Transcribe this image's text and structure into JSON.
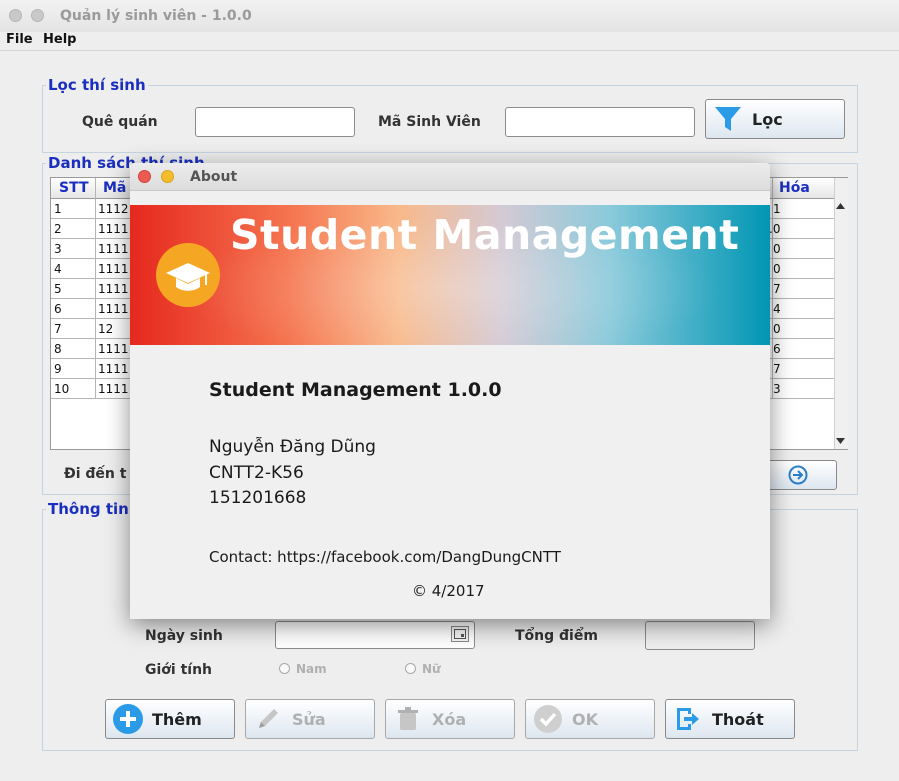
{
  "window": {
    "title": "Quản lý sinh viên - 1.0.0"
  },
  "menu": {
    "file": "File",
    "help": "Help"
  },
  "filter": {
    "group_label": "Lọc thí sinh",
    "hometown_label": "Quê quán",
    "hometown_value": "",
    "student_id_label": "Mã Sinh Viên",
    "student_id_value": "",
    "filter_button": "Lọc"
  },
  "list": {
    "group_label": "Danh sách thí sinh",
    "columns": {
      "stt": "STT",
      "ma": "Mã",
      "hoa": "Hóa"
    },
    "rows": [
      {
        "stt": "1",
        "ma": "1112",
        "hoa": "1"
      },
      {
        "stt": "2",
        "ma": "1111",
        "hoa": ".0"
      },
      {
        "stt": "3",
        "ma": "1111",
        "hoa": "0"
      },
      {
        "stt": "4",
        "ma": "1111",
        "hoa": "0"
      },
      {
        "stt": "5",
        "ma": "1111",
        "hoa": "7"
      },
      {
        "stt": "6",
        "ma": "1111",
        "hoa": "4"
      },
      {
        "stt": "7",
        "ma": "12",
        "hoa": "0"
      },
      {
        "stt": "8",
        "ma": "1111",
        "hoa": "6"
      },
      {
        "stt": "9",
        "ma": "1111",
        "hoa": "7"
      },
      {
        "stt": "10",
        "ma": "1111",
        "hoa": "3"
      }
    ],
    "goto_label": "Đi đến t"
  },
  "info": {
    "group_label": "Thông tin",
    "birthdate_label": "Ngày sinh",
    "birthdate_value": "",
    "total_label": "Tổng điểm",
    "total_value": "",
    "gender_label": "Giới tính",
    "male": "Nam",
    "female": "Nữ"
  },
  "actions": {
    "add": "Thêm",
    "edit": "Sửa",
    "delete": "Xóa",
    "ok": "OK",
    "exit": "Thoát"
  },
  "about": {
    "title": "About",
    "banner_title": "Student Management",
    "app_name": "Student Management 1.0.0",
    "author": "Nguyễn Đăng Dũng",
    "class": "CNTT2-K56",
    "student_id": "151201668",
    "contact": "Contact: https://facebook.com/DangDungCNTT",
    "copyright": "© 4/2017"
  },
  "colors": {
    "group_label": "#1a2fc0",
    "accent_blue": "#2b9be8",
    "banner_red": "#e6281e",
    "banner_teal": "#0096b4",
    "logo_orange": "#f5a623"
  }
}
